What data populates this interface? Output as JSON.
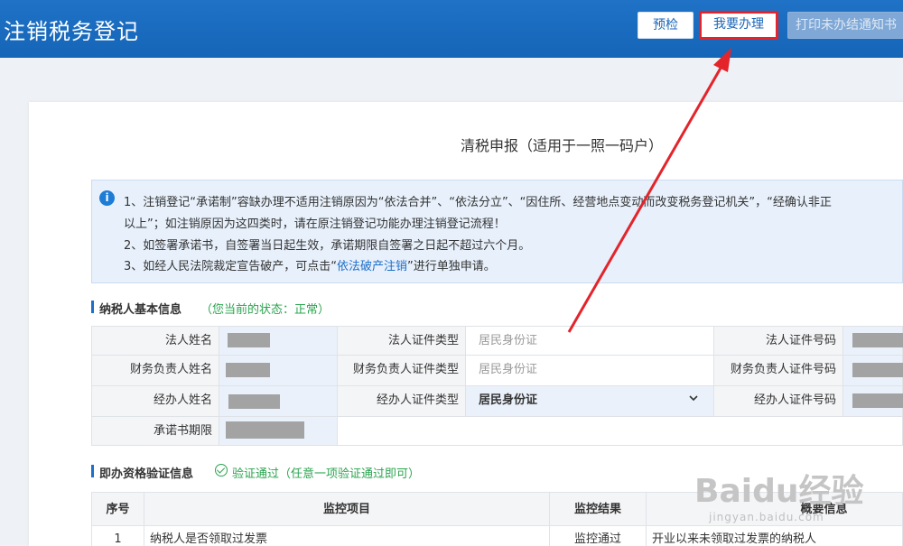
{
  "header": {
    "title": "注销税务登记",
    "buttons": {
      "precheck": "预检",
      "handle": "我要办理",
      "print": "打印未办结通知书"
    }
  },
  "form": {
    "title": "清税申报（适用于一照一码户）"
  },
  "notice": {
    "line1": "1、注销登记“承诺制”容缺办理不适用注销原因为“依法合并”、“依法分立”、“因住所、经营地点变动而改变税务登记机关”，“经确认非正",
    "line2": "以上”；如注销原因为这四类时，请在原注销登记功能办理注销登记流程！",
    "line3": "2、如签署承诺书，自签署当日起生效，承诺期限自签署之日起不超过六个月。",
    "line4_prefix": "3、如经人民法院裁定宣告破产，可点击“",
    "line4_link": "依法破产注销",
    "line4_suffix": "”进行单独申请。"
  },
  "taxpayer_section": {
    "title": "纳税人基本信息",
    "status": "（您当前的状态：正常）",
    "labels": {
      "legal_name": "法人姓名",
      "legal_id_type": "法人证件类型",
      "legal_id_no": "法人证件号码",
      "finance_name": "财务负责人姓名",
      "finance_id_type": "财务负责人证件类型",
      "finance_id_no": "财务负责人证件号码",
      "agent_name": "经办人姓名",
      "agent_id_type": "经办人证件类型",
      "agent_id_no": "经办人证件号码",
      "commit_term": "承诺书期限"
    },
    "values": {
      "legal_id_type": "居民身份证",
      "finance_id_type": "居民身份证",
      "agent_id_type": "居民身份证"
    }
  },
  "verify_section": {
    "title": "即办资格验证信息",
    "status": "验证通过（任意一项验证通过即可）",
    "columns": [
      "序号",
      "监控项目",
      "监控结果",
      "概要信息"
    ],
    "rows": [
      [
        "1",
        "纳税人是否领取过发票",
        "监控通过",
        "开业以来未领取过发票的纳税人"
      ]
    ]
  },
  "watermark": {
    "brand": "Baidu经验",
    "url": "jingyan.baidu.com"
  },
  "colors": {
    "header_bg": "#1565b8",
    "highlight": "#e3242b",
    "link": "#1d6fc9",
    "success": "#2aa44f"
  }
}
